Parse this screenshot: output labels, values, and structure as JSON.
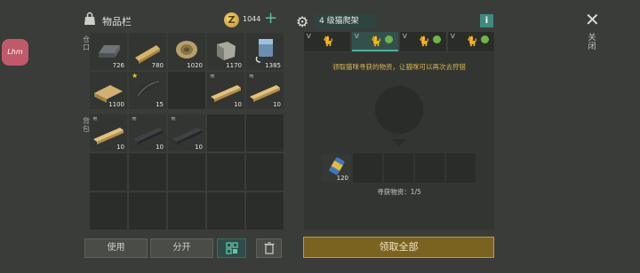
{
  "inventory": {
    "title": "物品栏",
    "coin_symbol": "Z",
    "coin_count": "1044",
    "plus_label": "+",
    "storage_label": "仓口",
    "backpack_label": "背包",
    "storage_slots": [
      {
        "icon": "metal-ingot-icon",
        "qty": "726"
      },
      {
        "icon": "wood-plank-icon",
        "qty": "780"
      },
      {
        "icon": "rope-coil-icon",
        "qty": "1020"
      },
      {
        "icon": "stone-block-icon",
        "qty": "1170"
      },
      {
        "icon": "battery-pack-icon",
        "qty": "1385"
      },
      {
        "icon": "boards-icon",
        "qty": "1100"
      },
      {
        "icon": "fish-icon",
        "qty": "15",
        "star": "★"
      },
      {
        "icon": "",
        "qty": ""
      },
      {
        "icon": "beam-icon",
        "qty": "10"
      },
      {
        "icon": "beam-icon",
        "qty": "10"
      }
    ],
    "backpack_slots": [
      {
        "icon": "beam-icon",
        "qty": "10"
      },
      {
        "icon": "steel-bar-icon",
        "qty": "10"
      },
      {
        "icon": "steel-bar-icon",
        "qty": "10"
      }
    ],
    "use_button": "使用",
    "split_button": "分开",
    "sort_icon": "grid-icon",
    "trash_icon": "trash-icon"
  },
  "station": {
    "name": "4 级猫爬架",
    "info_label": "i",
    "tabs": [
      {
        "v": "V",
        "cat": "cat-icon",
        "leaf": false,
        "active": false
      },
      {
        "v": "V",
        "cat": "cat-icon",
        "leaf": true,
        "active": true
      },
      {
        "v": "V",
        "cat": "cat-icon",
        "leaf": true,
        "active": false
      },
      {
        "v": "V",
        "cat": "cat-icon",
        "leaf": true,
        "active": false
      }
    ],
    "hint": "领取猫咪寻获的物资，让猫咪可以再次去狩猎",
    "reward_qty": "120",
    "found_text": "寻获物资：1/5",
    "collect_button": "领取全部"
  },
  "close": {
    "icon": "close-icon",
    "symbol": "✕",
    "label": "关闭"
  },
  "avatar": {
    "text": "Lhm"
  },
  "colors": {
    "accent": "#4bb09a",
    "gold": "#c79b2a",
    "hint": "#d9b84a"
  }
}
